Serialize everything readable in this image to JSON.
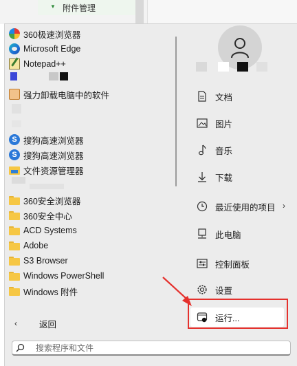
{
  "background": {
    "tree_node_label": "附件管理"
  },
  "apps": [
    {
      "label": "360极速浏览器",
      "icon": "360-browser-icon"
    },
    {
      "label": "Microsoft Edge",
      "icon": "edge-icon"
    },
    {
      "label": "Notepad++",
      "icon": "notepad-plus-plus-icon"
    },
    {
      "label": "强力卸载电脑中的软件",
      "icon": "uninstall-icon"
    },
    {
      "label": "搜狗高速浏览器",
      "icon": "sogou-browser-icon"
    },
    {
      "label": "搜狗高速浏览器",
      "icon": "sogou-browser-icon"
    },
    {
      "label": "文件资源管理器",
      "icon": "file-explorer-icon"
    },
    {
      "label": "360安全浏览器",
      "icon": "folder-icon"
    },
    {
      "label": "360安全中心",
      "icon": "folder-icon"
    },
    {
      "label": "ACD Systems",
      "icon": "folder-icon"
    },
    {
      "label": "Adobe",
      "icon": "folder-icon"
    },
    {
      "label": "S3 Browser",
      "icon": "folder-icon"
    },
    {
      "label": "Windows PowerShell",
      "icon": "folder-icon"
    },
    {
      "label": "Windows 附件",
      "icon": "folder-icon"
    }
  ],
  "back": {
    "label": "返回",
    "icon": "chevron-left-icon"
  },
  "search": {
    "placeholder": "搜索程序和文件",
    "icon": "search-icon"
  },
  "user": {
    "icon": "user-avatar-icon"
  },
  "right_items": [
    {
      "label": "文档",
      "icon": "document-icon"
    },
    {
      "label": "图片",
      "icon": "picture-icon"
    },
    {
      "label": "音乐",
      "icon": "music-icon"
    },
    {
      "label": "下载",
      "icon": "download-icon"
    },
    {
      "label": "最近使用的项目",
      "icon": "recent-clock-icon",
      "has_submenu": true
    },
    {
      "label": "此电脑",
      "icon": "computer-icon"
    },
    {
      "label": "控制面板",
      "icon": "control-panel-icon"
    },
    {
      "label": "设置",
      "icon": "settings-gear-icon"
    }
  ],
  "run": {
    "label": "运行...",
    "icon": "run-icon"
  },
  "colors": {
    "menu_bg": "#ececec",
    "highlight_border": "#e5312d",
    "arrow": "#e5312d",
    "accent_blue": "#2a78d8",
    "folder_yellow": "#f6c744"
  }
}
